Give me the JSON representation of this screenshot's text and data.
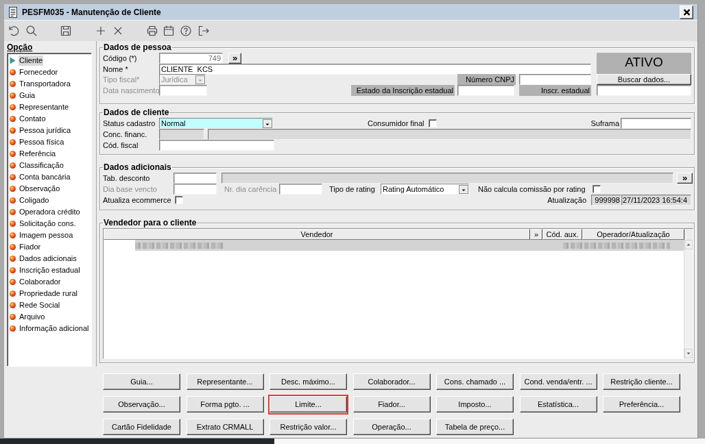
{
  "window": {
    "title": "PESFM035 - Manutenção de Cliente"
  },
  "sidebar": {
    "title": "Opção",
    "items": [
      {
        "label": "Cliente",
        "selected": true
      },
      {
        "label": "Fornecedor",
        "selected": false
      },
      {
        "label": "Transportadora",
        "selected": false
      },
      {
        "label": "Guia",
        "selected": false
      },
      {
        "label": "Representante",
        "selected": false
      },
      {
        "label": "Contato",
        "selected": false
      },
      {
        "label": "Pessoa jurídica",
        "selected": false
      },
      {
        "label": "Pessoa física",
        "selected": false
      },
      {
        "label": "Referência",
        "selected": false
      },
      {
        "label": "Classificação",
        "selected": false
      },
      {
        "label": "Conta bancária",
        "selected": false
      },
      {
        "label": "Observação",
        "selected": false
      },
      {
        "label": "Coligado",
        "selected": false
      },
      {
        "label": "Operadora crédito",
        "selected": false
      },
      {
        "label": "Solicitação cons.",
        "selected": false
      },
      {
        "label": "Imagem pessoa",
        "selected": false
      },
      {
        "label": "Fiador",
        "selected": false
      },
      {
        "label": "Dados adicionais",
        "selected": false
      },
      {
        "label": "Inscrição estadual",
        "selected": false
      },
      {
        "label": "Colaborador",
        "selected": false
      },
      {
        "label": "Propriedade rural",
        "selected": false
      },
      {
        "label": "Rede Social",
        "selected": false
      },
      {
        "label": "Arquivo",
        "selected": false
      },
      {
        "label": "Informação adicional",
        "selected": false
      }
    ]
  },
  "person": {
    "title": "Dados de pessoa",
    "status": "ATIVO",
    "code": {
      "label": "Código (*)",
      "value": "749",
      "button": "»"
    },
    "name": {
      "label": "Nome *",
      "value": "CLIENTE  KCS"
    },
    "fiscal_type": {
      "label": "Tipo fiscal*",
      "value": "Jurídica",
      "disabled": true
    },
    "cnpj": {
      "label": "Número CNPJ",
      "shaded": true
    },
    "search_button": "Buscar dados...",
    "birth_date": {
      "label": "Data nascimento",
      "disabled": true
    },
    "registration_state": {
      "label": "Estado da Inscrição estadual",
      "shaded": true
    },
    "state_registration": {
      "label": "Inscr. estadual",
      "shaded": true
    }
  },
  "client": {
    "title": "Dados de cliente",
    "status": {
      "label": "Status cadastro",
      "value": "Normal",
      "focused": true
    },
    "final_consumer": {
      "label": "Consumidor final",
      "checked": false
    },
    "suframa": {
      "label": "Suframa"
    },
    "financial": {
      "label": "Conc. financ."
    },
    "fiscal_code": {
      "label": "Cód. fiscal"
    }
  },
  "additional": {
    "title": "Dados adicionais",
    "discount_table": {
      "label": "Tab. desconto",
      "button": "»"
    },
    "due_day": {
      "label": "Dia base vencto",
      "disabled": true
    },
    "grace_days": {
      "label": "Nr. dia carência",
      "disabled": true
    },
    "rating_type": {
      "label": "Tipo de rating",
      "value": "Rating Automático"
    },
    "no_commission": {
      "label": "Não calcula comissão por rating",
      "checked": false
    },
    "ecommerce": {
      "label": "Atualiza ecommerce",
      "checked": false
    },
    "updated": {
      "label": "Atualização",
      "operator": "999998",
      "timestamp": "27/11/2023 16:54:4"
    }
  },
  "sellers": {
    "title": "Vendedor para o cliente",
    "columns": [
      "Vendedor",
      "»",
      "Cód. aux.",
      "Operador/Atualização"
    ],
    "rows": [
      {
        "selected": true
      }
    ]
  },
  "actions": [
    {
      "label": "Guia...",
      "highlighted": false
    },
    {
      "label": "Representante...",
      "highlighted": false
    },
    {
      "label": "Desc. máximo...",
      "highlighted": false
    },
    {
      "label": "Colaborador...",
      "highlighted": false
    },
    {
      "label": "Cons. chamado ...",
      "highlighted": false
    },
    {
      "label": "Cond. venda/entr. ...",
      "highlighted": false
    },
    {
      "label": "Restrição cliente...",
      "highlighted": false
    },
    {
      "label": "Observação...",
      "highlighted": false
    },
    {
      "label": "Forma pgto. ...",
      "highlighted": false
    },
    {
      "label": "Limite...",
      "highlighted": true
    },
    {
      "label": "Fiador...",
      "highlighted": false
    },
    {
      "label": "Imposto...",
      "highlighted": false
    },
    {
      "label": "Estatística...",
      "highlighted": false
    },
    {
      "label": "Preferência...",
      "highlighted": false
    },
    {
      "label": "Cartão Fidelidade",
      "highlighted": false
    },
    {
      "label": "Extrato CRMALL",
      "highlighted": false
    },
    {
      "label": "Restrição valor...",
      "highlighted": false
    },
    {
      "label": "Operação...",
      "highlighted": false
    },
    {
      "label": "Tabela de preço...",
      "highlighted": false
    }
  ]
}
